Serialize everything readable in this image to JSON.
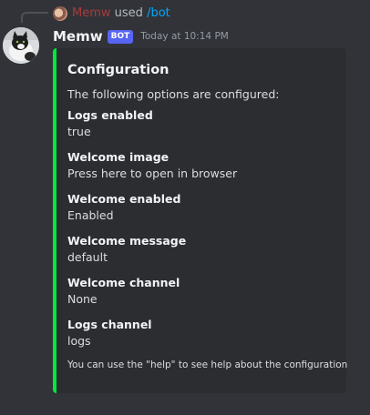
{
  "reply": {
    "user": "Memw",
    "used": "used",
    "command": "/bot"
  },
  "author": {
    "name": "Memw",
    "badge": "BOT",
    "timestamp": "Today at 10:14 PM"
  },
  "embed": {
    "color": "#00e83d",
    "title": "Configuration",
    "description": "The following options are configured:",
    "fields": [
      {
        "name": "Logs enabled",
        "value": "true"
      },
      {
        "name": "Welcome image",
        "value": "Press here to open in browser"
      },
      {
        "name": "Welcome enabled",
        "value": "Enabled"
      },
      {
        "name": "Welcome message",
        "value": "default"
      },
      {
        "name": "Welcome channel",
        "value": "None"
      },
      {
        "name": "Logs channel",
        "value": "logs"
      }
    ],
    "footer": "You can use the \"help\" to see help about the configuration"
  }
}
